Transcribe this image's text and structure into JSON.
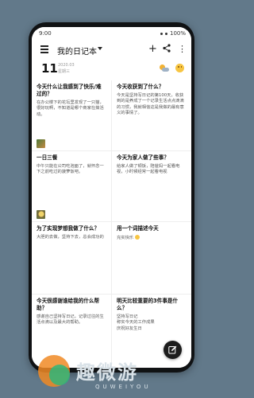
{
  "status": {
    "time": "9:00",
    "battery": "100%"
  },
  "appbar": {
    "title": "我的日记本"
  },
  "date": {
    "day": "11",
    "year_month": "2020.03",
    "weekday": "星期三"
  },
  "cards": [
    {
      "q": "今天什么让我感到了快乐/难过的？",
      "a": "在办公楼下的花坛里发现了一只猫，很好玩啊，不知道是哪个商家在搞活动。"
    },
    {
      "q": "今天收获到了什么？",
      "a": "今天是坚持写日记的第100天，收获到的是养成了一个记录生活点点滴滴的习惯，我就相信这是我做的最有意义的事情了。"
    },
    {
      "q": "一日三餐",
      "a": "中午只能在公司吃泡面了，就怀念一下之前吃过的菠萝饭吧。"
    },
    {
      "q": "今天为家人做了些事？",
      "a": "给家人做了顿饭，陪爸妈一起看电视，小时候经常一起看电视"
    },
    {
      "q": "为了实现梦想我做了什么？",
      "a": "大胆的去做，坚持下去，总会成功的"
    },
    {
      "q": "用一个词描述今天",
      "a": "充实快乐"
    },
    {
      "q": "今天很感谢谁给我的什么帮助？",
      "a": "感谢自己坚持写日记，记录过往的生活点滴以及最大的帮助。"
    },
    {
      "q": "明天比较重要的3件事是什么？",
      "a": "坚持写日记\n称实今天的工作成果\n庆祝好友生日"
    }
  ],
  "watermark": {
    "cn": "趣微游",
    "en": "QUWEIYOU"
  }
}
